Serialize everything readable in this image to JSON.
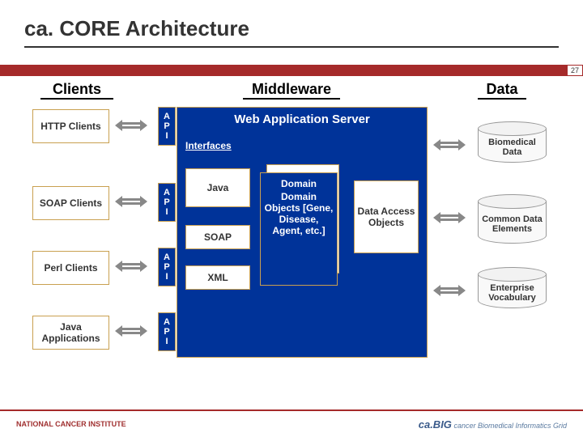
{
  "title": "ca. CORE Architecture",
  "pagenum": "27",
  "columns": {
    "clients": "Clients",
    "middleware": "Middleware",
    "data": "Data"
  },
  "clients": {
    "http": "HTTP Clients",
    "soap": "SOAP Clients",
    "perl": "Perl Clients",
    "java": "Java Applications"
  },
  "api": {
    "label": "A\nP\nI"
  },
  "was": {
    "title": "Web Application Server",
    "interfaces_label": "Interfaces",
    "java": "Java",
    "soap": "SOAP",
    "xml": "XML",
    "domain_heading": "Domain",
    "domain_body": "Domain Objects [Gene, Disease, Agent, etc.]",
    "dao": "Data Access Objects"
  },
  "data": {
    "bio": "Biomedical Data",
    "cde": "Common Data Elements",
    "ev": "Enterprise Vocabulary"
  },
  "footer": {
    "left": "NATIONAL CANCER INSTITUTE",
    "right_brand": "ca.BIG",
    "right_sub": "cancer Biomedical Informatics Grid"
  }
}
